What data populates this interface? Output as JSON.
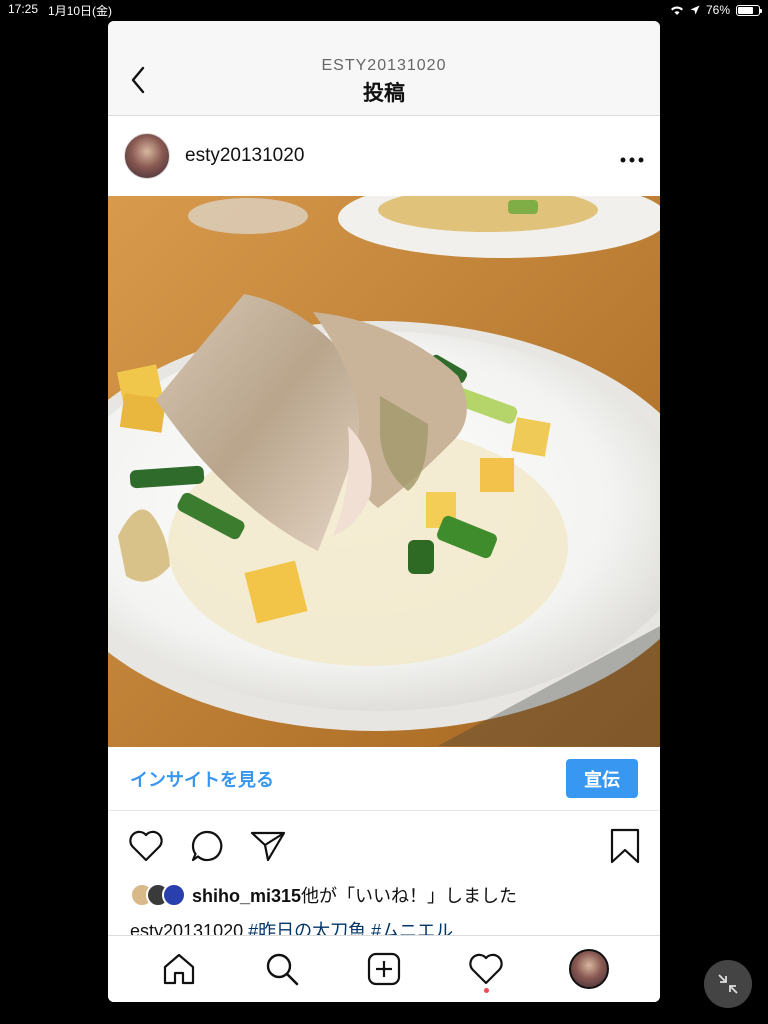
{
  "status": {
    "time": "17:25",
    "date": "1月10日(金)",
    "battery": "76%",
    "battery_level": 0.76
  },
  "nav": {
    "subtitle": "ESTY20131020",
    "title": "投稿",
    "back_icon": "chevron-left-icon"
  },
  "post": {
    "username": "esty20131020",
    "more_icon": "ellipsis-icon",
    "photo_icon": "post-photo"
  },
  "insights": {
    "link": "インサイトを見る",
    "promote": "宣伝"
  },
  "actions": [
    "heart-icon",
    "comment-icon",
    "share-icon",
    "bookmark-icon"
  ],
  "likes": {
    "user": "shiho_mi315",
    "text": "他が「いいね！」しました"
  },
  "caption": {
    "username": "esty20131020",
    "tags": " #昨日の太刀魚 #ムニエル"
  },
  "tabbar": [
    "home-icon",
    "search-icon",
    "add-icon",
    "activity-icon",
    "profile-icon"
  ],
  "colors": {
    "accent": "#3897f0",
    "notification_dot": "#ed4956"
  }
}
